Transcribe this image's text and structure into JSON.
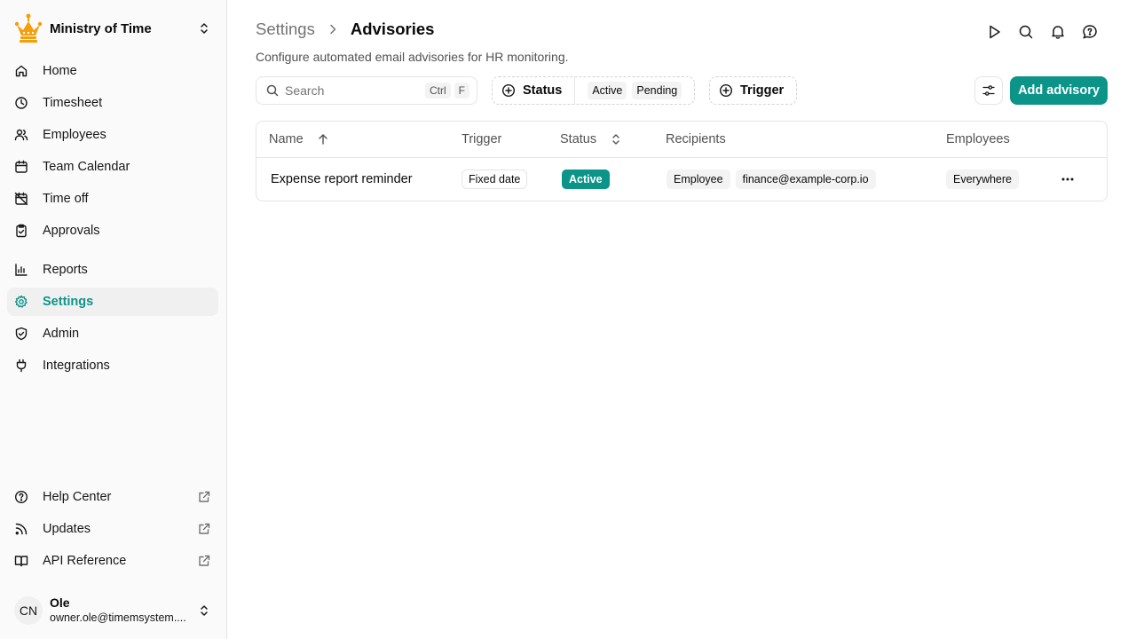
{
  "sidebar": {
    "org_name": "Ministry of Time",
    "nav": [
      {
        "label": "Home",
        "icon": "home-icon"
      },
      {
        "label": "Timesheet",
        "icon": "clock-icon"
      },
      {
        "label": "Employees",
        "icon": "users-icon"
      },
      {
        "label": "Team Calendar",
        "icon": "calendar-icon"
      },
      {
        "label": "Time off",
        "icon": "calendar-off-icon"
      },
      {
        "label": "Approvals",
        "icon": "clipboard-check-icon"
      },
      {
        "label": "Reports",
        "icon": "chart-icon"
      },
      {
        "label": "Settings",
        "icon": "gear-icon",
        "active": true
      },
      {
        "label": "Admin",
        "icon": "shield-icon"
      },
      {
        "label": "Integrations",
        "icon": "plug-icon"
      }
    ],
    "bottom": [
      {
        "label": "Help Center",
        "icon": "help-circle-icon"
      },
      {
        "label": "Updates",
        "icon": "rss-icon"
      },
      {
        "label": "API Reference",
        "icon": "book-icon"
      }
    ],
    "user": {
      "initials": "CN",
      "name": "Ole",
      "email": "owner.ole@timemsystem...."
    }
  },
  "header": {
    "breadcrumb_parent": "Settings",
    "title": "Advisories",
    "description": "Configure automated email advisories for HR monitoring."
  },
  "toolbar": {
    "search_placeholder": "Search",
    "shortcut_ctrl": "Ctrl",
    "shortcut_key": "F",
    "status_filter": {
      "label": "Status",
      "values": [
        "Active",
        "Pending"
      ]
    },
    "trigger_filter": {
      "label": "Trigger"
    },
    "add_label": "Add advisory"
  },
  "table": {
    "columns": [
      "Name",
      "Trigger",
      "Status",
      "Recipients",
      "Employees"
    ],
    "rows": [
      {
        "name": "Expense report reminder",
        "trigger": "Fixed date",
        "status": "Active",
        "recipients": [
          "Employee",
          "finance@example-corp.io"
        ],
        "employees": "Everywhere"
      }
    ]
  },
  "colors": {
    "accent": "#0d9488",
    "crown": "#f59e0b"
  }
}
